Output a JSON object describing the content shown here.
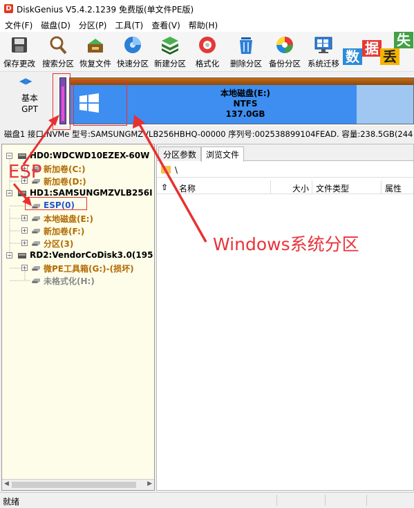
{
  "window": {
    "logo": "D",
    "title": "DiskGenius V5.4.2.1239 免费版(单文件PE版)"
  },
  "menu": [
    "文件(F)",
    "磁盘(D)",
    "分区(P)",
    "工具(T)",
    "查看(V)",
    "帮助(H)"
  ],
  "toolbar": [
    {
      "label": "保存更改",
      "icon": "save-icon"
    },
    {
      "label": "搜索分区",
      "icon": "search-partition-icon"
    },
    {
      "label": "恢复文件",
      "icon": "recover-files-icon"
    },
    {
      "label": "快速分区",
      "icon": "quick-partition-icon"
    },
    {
      "label": "新建分区",
      "icon": "new-partition-icon"
    },
    {
      "label": "格式化",
      "icon": "format-icon"
    },
    {
      "label": "删除分区",
      "icon": "delete-partition-icon"
    },
    {
      "label": "备份分区",
      "icon": "backup-partition-icon"
    },
    {
      "label": "系统迁移",
      "icon": "system-migration-icon"
    }
  ],
  "banner": [
    "数",
    "据",
    "丢",
    "失"
  ],
  "disk_map": {
    "type_line1": "基本",
    "type_line2": "GPT",
    "partition_name": "本地磁盘(E:)",
    "partition_fs": "NTFS",
    "partition_size": "137.0GB"
  },
  "disk_info": "磁盘1 接口:NVMe 型号:SAMSUNGMZVLB256HBHQ-00000 序列号:002538899104FEAD. 容量:238.5GB(244",
  "tree": [
    {
      "label": "HD0:WDCWD10EZEX-60W",
      "kind": "disk",
      "expander": "-"
    },
    {
      "label": "新加卷(C:)",
      "kind": "vol",
      "expander": "+"
    },
    {
      "label": "新加卷(D:)",
      "kind": "vol",
      "expander": "+"
    },
    {
      "label": "HD1:SAMSUNGMZVLB256I",
      "kind": "disk",
      "expander": "-"
    },
    {
      "label": "ESP(0)",
      "kind": "esp",
      "expander": ""
    },
    {
      "label": "本地磁盘(E:)",
      "kind": "vol",
      "expander": "+"
    },
    {
      "label": "新加卷(F:)",
      "kind": "vol",
      "expander": "+"
    },
    {
      "label": "分区(3)",
      "kind": "vol",
      "expander": "+"
    },
    {
      "label": "RD2:VendorCoDisk3.0(195",
      "kind": "disk",
      "expander": "-"
    },
    {
      "label": "微PE工具箱(G:)-(损坏)",
      "kind": "vol",
      "expander": "+"
    },
    {
      "label": "未格式化(H:)",
      "kind": "gray",
      "expander": ""
    }
  ],
  "tabs": [
    "分区参数",
    "浏览文件"
  ],
  "path": "\\",
  "columns": [
    "名称",
    "大小",
    "文件类型",
    "属性"
  ],
  "status": "就绪",
  "annotations": {
    "esp": "ESP",
    "windows": "Windows系统分区"
  },
  "colors": {
    "annotation": "#e83030",
    "partition_used": "#3d8ef0",
    "esp": "#7a4bb5"
  }
}
